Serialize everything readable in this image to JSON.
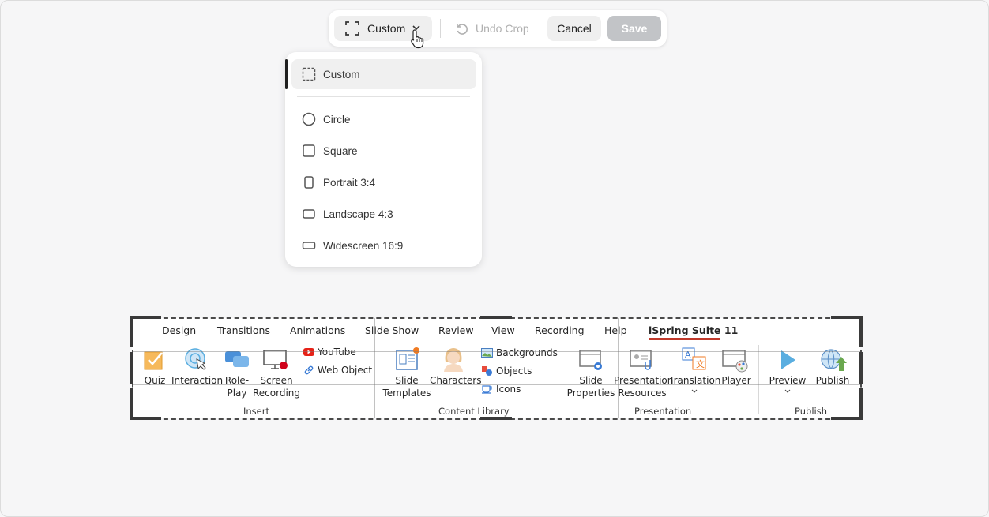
{
  "toolbar": {
    "crop_mode_label": "Custom",
    "undo_label": "Undo Crop",
    "cancel_label": "Cancel",
    "save_label": "Save"
  },
  "menu": {
    "items": [
      {
        "label": "Custom",
        "icon": "custom-crop-icon",
        "selected": true
      },
      {
        "label": "Circle",
        "icon": "circle-icon"
      },
      {
        "label": "Square",
        "icon": "square-icon"
      },
      {
        "label": "Portrait 3:4",
        "icon": "portrait-icon"
      },
      {
        "label": "Landscape 4:3",
        "icon": "landscape-icon"
      },
      {
        "label": "Widescreen 16:9",
        "icon": "widescreen-icon"
      }
    ]
  },
  "ribbon": {
    "tabs": [
      "Design",
      "Transitions",
      "Animations",
      "Slide Show",
      "Review",
      "View",
      "Recording",
      "Help",
      "iSpring Suite 11"
    ],
    "buttons": {
      "quiz": "Quiz",
      "interaction": "Interaction",
      "roleplay_1": "Role-",
      "roleplay_2": "Play",
      "screen_1": "Screen",
      "screen_2": "Recording",
      "youtube": "YouTube",
      "web_object": "Web Object",
      "slide_templates_1": "Slide",
      "slide_templates_2": "Templates",
      "characters": "Characters",
      "backgrounds": "Backgrounds",
      "objects": "Objects",
      "icons": "Icons",
      "slide_props_1": "Slide",
      "slide_props_2": "Properties",
      "pres_res_1": "Presentation",
      "pres_res_2": "Resources",
      "translation": "Translation",
      "player": "Player",
      "preview": "Preview",
      "publish": "Publish"
    },
    "groups": {
      "insert": "Insert",
      "content_library": "Content Library",
      "presentation": "Presentation",
      "publish": "Publish"
    }
  },
  "colors": {
    "accent_underline": "#c0392b",
    "save_disabled": "#c2c4c7"
  }
}
